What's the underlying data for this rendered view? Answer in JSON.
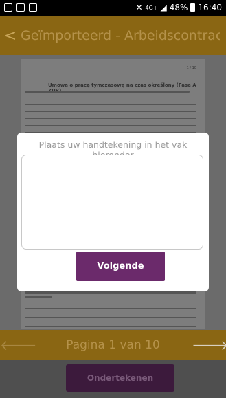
{
  "status_bar": {
    "network": "4G+",
    "battery_percent": "48%",
    "time": "16:40"
  },
  "header": {
    "back_icon": "chevron-left-icon",
    "title": "Geïmporteerd - ArbeidscontractP..."
  },
  "document": {
    "page_marker": "1 / 10",
    "heading": "Umowa o pracę tymczasową na czas określony (Fase A ZUR)"
  },
  "signature_dialog": {
    "prompt": "Plaats uw handtekening in het vak hieronder",
    "next_label": "Volgende"
  },
  "pagination": {
    "label": "Pagina 1 van 10",
    "prev_icon": "arrow-left-icon",
    "next_icon": "arrow-right-icon"
  },
  "footer": {
    "sign_label": "Ondertekenen"
  },
  "colors": {
    "accent_gold": "#8a6613",
    "accent_purple": "#6b2a6b"
  }
}
